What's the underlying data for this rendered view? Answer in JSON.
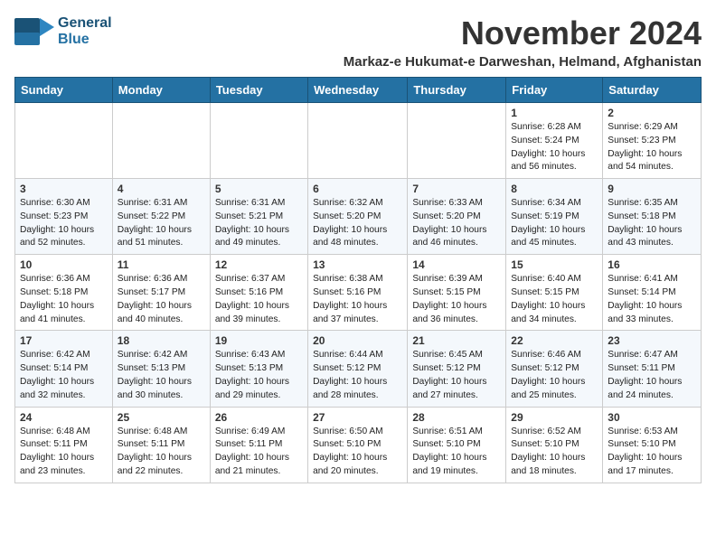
{
  "header": {
    "logo_line1": "General",
    "logo_line2": "Blue",
    "month": "November 2024",
    "location": "Markaz-e Hukumat-e Darweshan, Helmand, Afghanistan"
  },
  "weekdays": [
    "Sunday",
    "Monday",
    "Tuesday",
    "Wednesday",
    "Thursday",
    "Friday",
    "Saturday"
  ],
  "weeks": [
    [
      {
        "day": "",
        "info": ""
      },
      {
        "day": "",
        "info": ""
      },
      {
        "day": "",
        "info": ""
      },
      {
        "day": "",
        "info": ""
      },
      {
        "day": "",
        "info": ""
      },
      {
        "day": "1",
        "info": "Sunrise: 6:28 AM\nSunset: 5:24 PM\nDaylight: 10 hours and 56 minutes."
      },
      {
        "day": "2",
        "info": "Sunrise: 6:29 AM\nSunset: 5:23 PM\nDaylight: 10 hours and 54 minutes."
      }
    ],
    [
      {
        "day": "3",
        "info": "Sunrise: 6:30 AM\nSunset: 5:23 PM\nDaylight: 10 hours and 52 minutes."
      },
      {
        "day": "4",
        "info": "Sunrise: 6:31 AM\nSunset: 5:22 PM\nDaylight: 10 hours and 51 minutes."
      },
      {
        "day": "5",
        "info": "Sunrise: 6:31 AM\nSunset: 5:21 PM\nDaylight: 10 hours and 49 minutes."
      },
      {
        "day": "6",
        "info": "Sunrise: 6:32 AM\nSunset: 5:20 PM\nDaylight: 10 hours and 48 minutes."
      },
      {
        "day": "7",
        "info": "Sunrise: 6:33 AM\nSunset: 5:20 PM\nDaylight: 10 hours and 46 minutes."
      },
      {
        "day": "8",
        "info": "Sunrise: 6:34 AM\nSunset: 5:19 PM\nDaylight: 10 hours and 45 minutes."
      },
      {
        "day": "9",
        "info": "Sunrise: 6:35 AM\nSunset: 5:18 PM\nDaylight: 10 hours and 43 minutes."
      }
    ],
    [
      {
        "day": "10",
        "info": "Sunrise: 6:36 AM\nSunset: 5:18 PM\nDaylight: 10 hours and 41 minutes."
      },
      {
        "day": "11",
        "info": "Sunrise: 6:36 AM\nSunset: 5:17 PM\nDaylight: 10 hours and 40 minutes."
      },
      {
        "day": "12",
        "info": "Sunrise: 6:37 AM\nSunset: 5:16 PM\nDaylight: 10 hours and 39 minutes."
      },
      {
        "day": "13",
        "info": "Sunrise: 6:38 AM\nSunset: 5:16 PM\nDaylight: 10 hours and 37 minutes."
      },
      {
        "day": "14",
        "info": "Sunrise: 6:39 AM\nSunset: 5:15 PM\nDaylight: 10 hours and 36 minutes."
      },
      {
        "day": "15",
        "info": "Sunrise: 6:40 AM\nSunset: 5:15 PM\nDaylight: 10 hours and 34 minutes."
      },
      {
        "day": "16",
        "info": "Sunrise: 6:41 AM\nSunset: 5:14 PM\nDaylight: 10 hours and 33 minutes."
      }
    ],
    [
      {
        "day": "17",
        "info": "Sunrise: 6:42 AM\nSunset: 5:14 PM\nDaylight: 10 hours and 32 minutes."
      },
      {
        "day": "18",
        "info": "Sunrise: 6:42 AM\nSunset: 5:13 PM\nDaylight: 10 hours and 30 minutes."
      },
      {
        "day": "19",
        "info": "Sunrise: 6:43 AM\nSunset: 5:13 PM\nDaylight: 10 hours and 29 minutes."
      },
      {
        "day": "20",
        "info": "Sunrise: 6:44 AM\nSunset: 5:12 PM\nDaylight: 10 hours and 28 minutes."
      },
      {
        "day": "21",
        "info": "Sunrise: 6:45 AM\nSunset: 5:12 PM\nDaylight: 10 hours and 27 minutes."
      },
      {
        "day": "22",
        "info": "Sunrise: 6:46 AM\nSunset: 5:12 PM\nDaylight: 10 hours and 25 minutes."
      },
      {
        "day": "23",
        "info": "Sunrise: 6:47 AM\nSunset: 5:11 PM\nDaylight: 10 hours and 24 minutes."
      }
    ],
    [
      {
        "day": "24",
        "info": "Sunrise: 6:48 AM\nSunset: 5:11 PM\nDaylight: 10 hours and 23 minutes."
      },
      {
        "day": "25",
        "info": "Sunrise: 6:48 AM\nSunset: 5:11 PM\nDaylight: 10 hours and 22 minutes."
      },
      {
        "day": "26",
        "info": "Sunrise: 6:49 AM\nSunset: 5:11 PM\nDaylight: 10 hours and 21 minutes."
      },
      {
        "day": "27",
        "info": "Sunrise: 6:50 AM\nSunset: 5:10 PM\nDaylight: 10 hours and 20 minutes."
      },
      {
        "day": "28",
        "info": "Sunrise: 6:51 AM\nSunset: 5:10 PM\nDaylight: 10 hours and 19 minutes."
      },
      {
        "day": "29",
        "info": "Sunrise: 6:52 AM\nSunset: 5:10 PM\nDaylight: 10 hours and 18 minutes."
      },
      {
        "day": "30",
        "info": "Sunrise: 6:53 AM\nSunset: 5:10 PM\nDaylight: 10 hours and 17 minutes."
      }
    ]
  ]
}
